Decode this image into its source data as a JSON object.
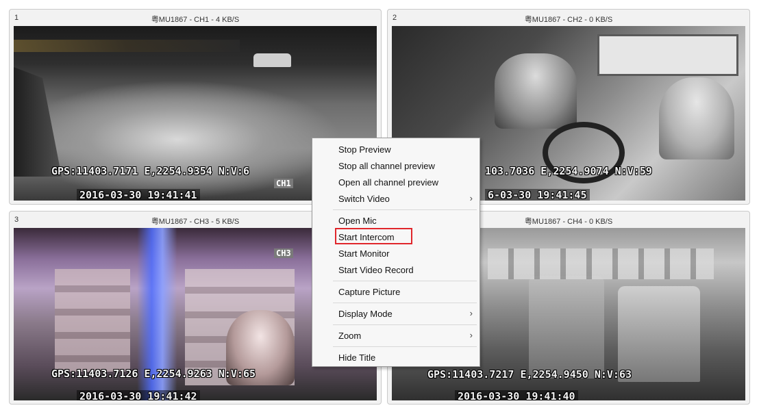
{
  "panels": [
    {
      "num": "1",
      "title": "粤MU1867 - CH1 - 4 KB/S",
      "gps": "GPS:11403.7171 E,2254.9354 N:V:6",
      "time": "2016-03-30 19:41:41",
      "ch": "CH1"
    },
    {
      "num": "2",
      "title": "粤MU1867 - CH2 - 0 KB/S",
      "gps": "103.7036 E,2254.9074 N:V:59",
      "time": "6-03-30 19:41:45",
      "ch": ""
    },
    {
      "num": "3",
      "title": "粤MU1867 - CH3 - 5 KB/S",
      "gps": "GPS:11403.7126 E,2254.9263 N:V:65",
      "time": "2016-03-30 19:41:42",
      "ch": "CH3"
    },
    {
      "num": "",
      "title": "粤MU1867 - CH4 - 0 KB/S",
      "gps": "GPS:11403.7217 E,2254.9450 N:V:63",
      "time": "2016-03-30 19:41:40",
      "ch": ""
    }
  ],
  "context_menu": {
    "items": [
      {
        "label": "Stop Preview",
        "submenu": false
      },
      {
        "label": "Stop all channel preview",
        "submenu": false
      },
      {
        "label": "Open all channel preview",
        "submenu": false
      },
      {
        "label": "Switch Video",
        "submenu": true
      },
      {
        "label": "Open Mic",
        "submenu": false
      },
      {
        "label": "Start Intercom",
        "submenu": false,
        "highlighted": true
      },
      {
        "label": "Start Monitor",
        "submenu": false
      },
      {
        "label": "Start Video Record",
        "submenu": false
      },
      {
        "label": "Capture Picture",
        "submenu": false
      },
      {
        "label": "Display Mode",
        "submenu": true
      },
      {
        "label": "Zoom",
        "submenu": true
      },
      {
        "label": "Hide Title",
        "submenu": false
      }
    ],
    "submenu_arrow": "›",
    "highlight_color": "#e0262b"
  }
}
